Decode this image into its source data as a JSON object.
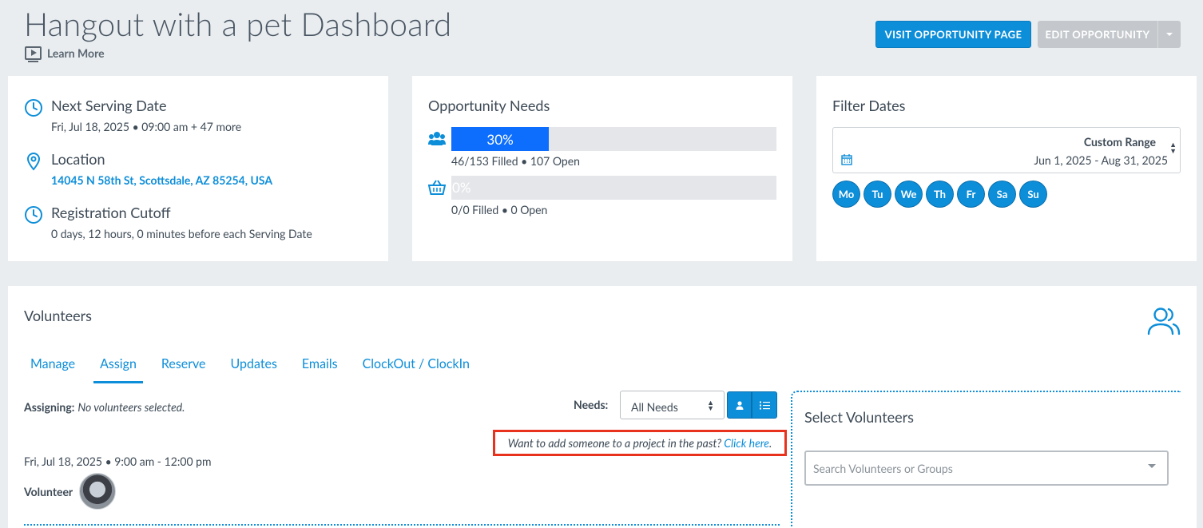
{
  "header": {
    "title": "Hangout with a pet Dashboard",
    "learn_more": "Learn More",
    "visit_button": "VISIT OPPORTUNITY PAGE",
    "edit_button": "EDIT OPPORTUNITY"
  },
  "info": {
    "next_serving_title": "Next Serving Date",
    "next_serving_value": "Fri, Jul 18, 2025 • 09:00 am + 47 more",
    "location_title": "Location",
    "location_value": "14045 N 58th St, Scottsdale, AZ 85254, USA",
    "cutoff_title": "Registration Cutoff",
    "cutoff_value": "0 days, 12 hours, 0 minutes before each Serving Date"
  },
  "needs": {
    "title": "Opportunity Needs",
    "volunteers": {
      "percent_label": "30%",
      "fill_fraction": 0.3,
      "summary": "46/153 Filled • 107 Open",
      "icon": "users-icon"
    },
    "items": {
      "percent_label": "0%",
      "fill_fraction": 0.0,
      "summary": "0/0 Filled • 0 Open",
      "icon": "basket-icon"
    }
  },
  "filter": {
    "title": "Filter Dates",
    "range_label": "Custom Range",
    "range_value": "Jun 1, 2025 - Aug 31, 2025",
    "days": [
      "Mo",
      "Tu",
      "We",
      "Th",
      "Fr",
      "Sa",
      "Su"
    ]
  },
  "volunteers": {
    "title": "Volunteers",
    "tabs": [
      "Manage",
      "Assign",
      "Reserve",
      "Updates",
      "Emails",
      "ClockOut / ClockIn"
    ],
    "active_tab": "Assign",
    "assigning_label": "Assigning:",
    "assigning_value": "No volunteers selected.",
    "needs_label": "Needs:",
    "needs_value": "All Needs",
    "past_text": "Want to add someone to a project in the past?",
    "past_link": "Click here",
    "past_period": ".",
    "shift_line": "Fri, Jul 18, 2025 • 9:00 am - 12:00 pm",
    "volunteer_label": "Volunteer"
  },
  "select_panel": {
    "title": "Select Volunteers",
    "search_placeholder": "Search Volunteers or Groups"
  },
  "colors": {
    "accent": "#0d8ed9",
    "bar_fill": "#0d6efd",
    "highlight_border": "#e8321e"
  }
}
